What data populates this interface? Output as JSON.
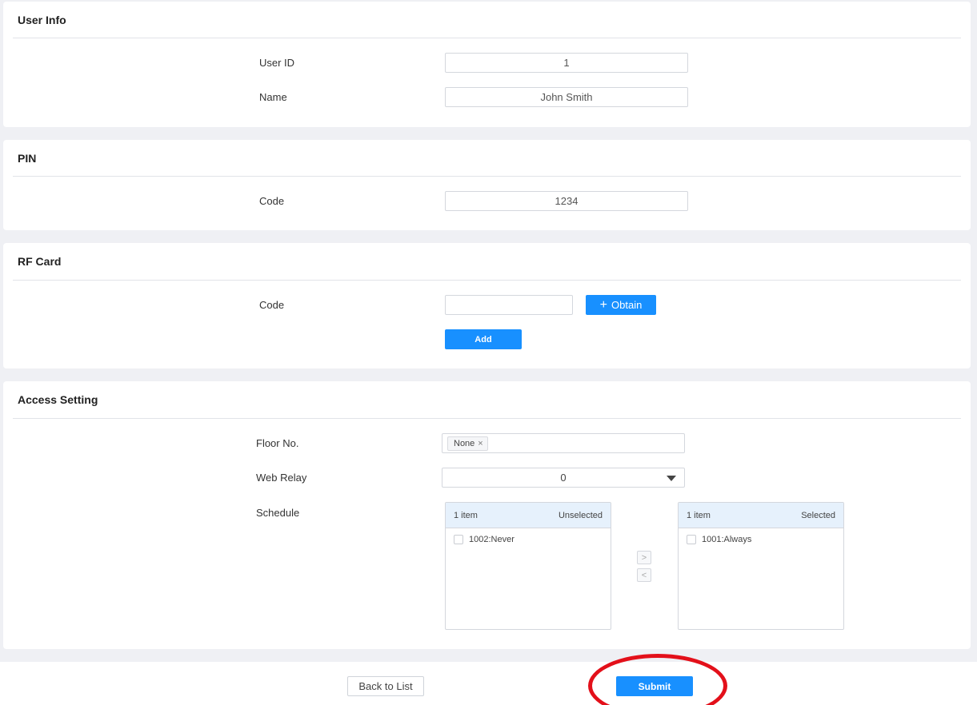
{
  "sections": {
    "user_info": {
      "title": "User Info",
      "user_id_label": "User ID",
      "user_id_value": "1",
      "name_label": "Name",
      "name_value": "John Smith"
    },
    "pin": {
      "title": "PIN",
      "code_label": "Code",
      "code_value": "1234"
    },
    "rf_card": {
      "title": "RF Card",
      "code_label": "Code",
      "code_value": "",
      "obtain_icon": "+",
      "obtain_label": "Obtain",
      "add_label": "Add"
    },
    "access_setting": {
      "title": "Access Setting",
      "floor_label": "Floor No.",
      "floor_tag": "None",
      "floor_tag_close": "×",
      "web_relay_label": "Web Relay",
      "web_relay_value": "0",
      "schedule_label": "Schedule",
      "unselected": {
        "count": "1 item",
        "title": "Unselected",
        "items": [
          "1002:Never"
        ]
      },
      "selected": {
        "count": "1 item",
        "title": "Selected",
        "items": [
          "1001:Always"
        ]
      },
      "move_right": ">",
      "move_left": "<"
    }
  },
  "footer": {
    "back_label": "Back to List",
    "submit_label": "Submit"
  },
  "colors": {
    "primary": "#1890ff",
    "background": "#eff0f4",
    "highlight": "#e3101a"
  }
}
